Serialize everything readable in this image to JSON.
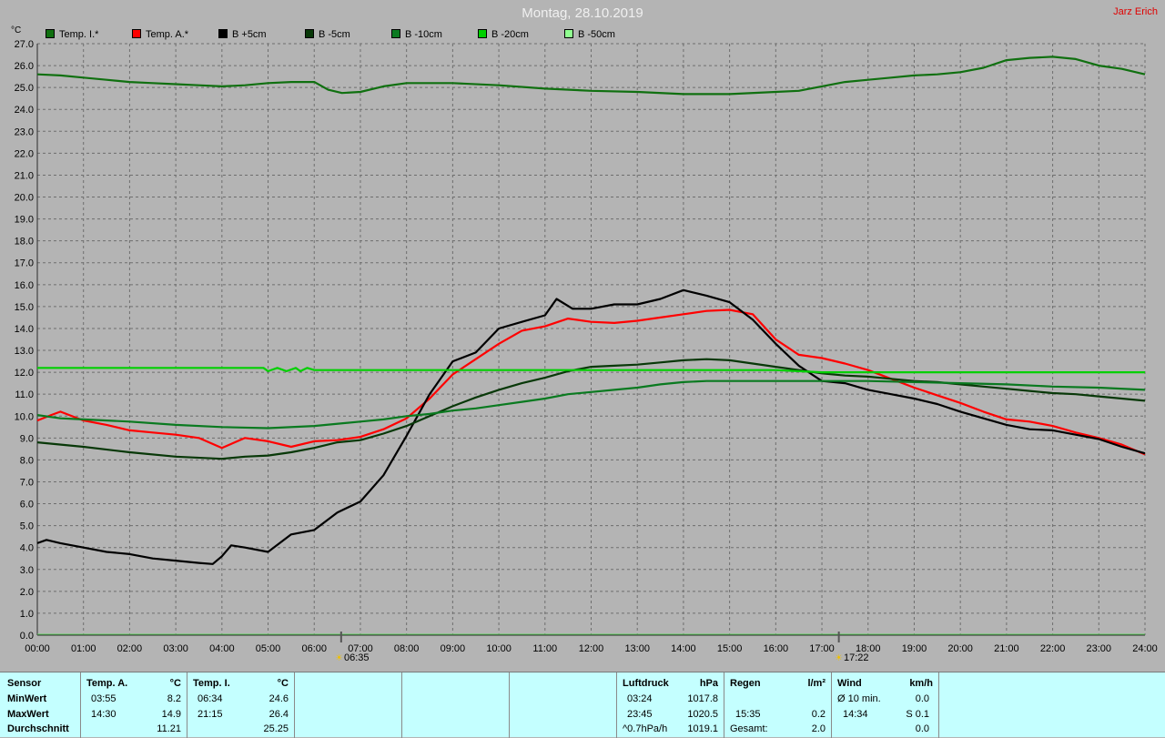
{
  "header": {
    "title": "Montag, 28.10.2019",
    "author": "Jarz Erich",
    "unit": "°C"
  },
  "legend": [
    {
      "label": "Temp. I.*",
      "color": "#107010"
    },
    {
      "label": "Temp. A.*",
      "color": "#ff0000"
    },
    {
      "label": "B +5cm",
      "color": "#000000"
    },
    {
      "label": "B -5cm",
      "color": "#083808"
    },
    {
      "label": "B -10cm",
      "color": "#0a7a20"
    },
    {
      "label": "B -20cm",
      "color": "#00d000"
    },
    {
      "label": "B -50cm",
      "color": "#90ff90"
    }
  ],
  "events": {
    "sunrise": "06:35",
    "sunset": "17:22"
  },
  "chart_data": {
    "type": "line",
    "ylim": [
      0,
      27
    ],
    "yticks": [
      "0.0",
      "1.0",
      "2.0",
      "3.0",
      "4.0",
      "5.0",
      "6.0",
      "7.0",
      "8.0",
      "9.0",
      "10.0",
      "11.0",
      "12.0",
      "13.0",
      "14.0",
      "15.0",
      "16.0",
      "17.0",
      "18.0",
      "19.0",
      "20.0",
      "21.0",
      "22.0",
      "23.0",
      "24.0",
      "25.0",
      "26.0",
      "27.0"
    ],
    "xlim": [
      0,
      24
    ],
    "xticks": [
      "00:00",
      "01:00",
      "02:00",
      "03:00",
      "04:00",
      "05:00",
      "06:00",
      "07:00",
      "08:00",
      "09:00",
      "10:00",
      "11:00",
      "12:00",
      "13:00",
      "14:00",
      "15:00",
      "16:00",
      "17:00",
      "18:00",
      "19:00",
      "20:00",
      "21:00",
      "22:00",
      "23:00",
      "24:00"
    ],
    "series": [
      {
        "name": "Temp. I.*",
        "color": "#107010",
        "x": [
          0,
          0.5,
          1,
          1.5,
          2,
          2.5,
          3,
          3.5,
          4,
          4.5,
          5,
          5.5,
          6,
          6.3,
          6.6,
          7,
          7.5,
          8,
          8.5,
          9,
          10,
          11,
          12,
          13,
          14,
          15,
          16,
          16.5,
          17,
          17.5,
          18,
          18.5,
          19,
          19.5,
          20,
          20.5,
          21,
          21.5,
          22,
          22.5,
          23,
          23.5,
          24
        ],
        "y": [
          25.6,
          25.55,
          25.45,
          25.35,
          25.25,
          25.2,
          25.15,
          25.1,
          25.05,
          25.1,
          25.2,
          25.25,
          25.25,
          24.9,
          24.75,
          24.8,
          25.05,
          25.2,
          25.2,
          25.2,
          25.1,
          24.95,
          24.85,
          24.8,
          24.7,
          24.7,
          24.8,
          24.85,
          25.05,
          25.25,
          25.35,
          25.45,
          25.55,
          25.6,
          25.7,
          25.9,
          26.25,
          26.35,
          26.4,
          26.3,
          26,
          25.85,
          25.6
        ]
      },
      {
        "name": "Temp. A.*",
        "color": "#ff0000",
        "x": [
          0,
          0.3,
          0.5,
          1,
          1.5,
          2,
          2.5,
          3,
          3.5,
          4,
          4.5,
          5,
          5.5,
          6,
          6.5,
          7,
          7.5,
          8,
          8.5,
          9,
          9.5,
          10,
          10.5,
          11,
          11.5,
          12,
          12.5,
          13,
          13.5,
          14,
          14.5,
          15,
          15.5,
          16,
          16.5,
          17,
          17.5,
          18,
          18.5,
          19,
          19.5,
          20,
          20.5,
          21,
          21.5,
          22,
          22.5,
          23,
          23.5,
          24
        ],
        "y": [
          9.8,
          10.05,
          10.2,
          9.8,
          9.6,
          9.35,
          9.25,
          9.15,
          9.0,
          8.55,
          9.0,
          8.85,
          8.6,
          8.85,
          8.9,
          9.05,
          9.4,
          9.9,
          10.8,
          11.9,
          12.6,
          13.3,
          13.9,
          14.1,
          14.45,
          14.3,
          14.25,
          14.35,
          14.5,
          14.65,
          14.8,
          14.85,
          14.65,
          13.5,
          12.8,
          12.65,
          12.4,
          12.1,
          11.7,
          11.3,
          10.95,
          10.6,
          10.2,
          9.85,
          9.75,
          9.55,
          9.25,
          9.0,
          8.7,
          8.25
        ]
      },
      {
        "name": "B +5cm",
        "color": "#000000",
        "x": [
          0,
          0.2,
          0.5,
          1,
          1.5,
          2,
          2.5,
          3,
          3.5,
          3.8,
          4,
          4.2,
          4.5,
          5,
          5.5,
          6,
          6.5,
          7,
          7.5,
          8,
          8.5,
          9,
          9.5,
          10,
          10.5,
          11,
          11.25,
          11.6,
          12,
          12.5,
          13,
          13.5,
          14,
          14.5,
          15,
          15.5,
          16,
          16.5,
          17,
          17.5,
          18,
          18.5,
          19,
          19.5,
          20,
          20.5,
          21,
          21.5,
          22,
          22.5,
          23,
          23.5,
          24
        ],
        "y": [
          4.2,
          4.35,
          4.2,
          4.0,
          3.8,
          3.7,
          3.5,
          3.4,
          3.3,
          3.25,
          3.6,
          4.1,
          4.0,
          3.8,
          4.6,
          4.8,
          5.6,
          6.1,
          7.3,
          9.1,
          11.0,
          12.5,
          12.9,
          14.0,
          14.3,
          14.6,
          15.35,
          14.9,
          14.9,
          15.1,
          15.1,
          15.35,
          15.75,
          15.5,
          15.2,
          14.4,
          13.3,
          12.3,
          11.6,
          11.5,
          11.2,
          11.0,
          10.8,
          10.55,
          10.2,
          9.9,
          9.6,
          9.4,
          9.35,
          9.15,
          8.95,
          8.6,
          8.3
        ]
      },
      {
        "name": "B -5cm",
        "color": "#083808",
        "x": [
          0,
          1,
          2,
          3,
          4,
          4.5,
          5,
          5.5,
          6,
          6.5,
          7,
          7.5,
          8,
          8.5,
          9,
          9.5,
          10,
          10.5,
          11,
          11.5,
          12,
          12.5,
          13,
          13.5,
          14,
          14.5,
          15,
          15.5,
          16,
          16.5,
          17,
          17.5,
          18,
          18.5,
          19,
          19.5,
          20,
          20.5,
          21,
          21.5,
          22,
          22.5,
          23,
          23.5,
          24
        ],
        "y": [
          8.8,
          8.6,
          8.35,
          8.15,
          8.05,
          8.15,
          8.2,
          8.35,
          8.55,
          8.8,
          8.9,
          9.2,
          9.55,
          10.0,
          10.45,
          10.85,
          11.2,
          11.5,
          11.75,
          12.05,
          12.25,
          12.3,
          12.35,
          12.45,
          12.55,
          12.6,
          12.55,
          12.4,
          12.25,
          12.1,
          11.95,
          11.85,
          11.8,
          11.7,
          11.6,
          11.55,
          11.45,
          11.35,
          11.25,
          11.15,
          11.05,
          11.0,
          10.9,
          10.8,
          10.7
        ]
      },
      {
        "name": "B -10cm",
        "color": "#0a7a20",
        "x": [
          0,
          0.5,
          1,
          2,
          3,
          4,
          5,
          6,
          7,
          7.5,
          8,
          8.5,
          9,
          9.5,
          10,
          10.5,
          11,
          11.5,
          12,
          12.5,
          13,
          13.5,
          14,
          14.5,
          15,
          16,
          17,
          17.5,
          18,
          19,
          20,
          21,
          22,
          23,
          24
        ],
        "y": [
          10.05,
          9.9,
          9.85,
          9.75,
          9.6,
          9.5,
          9.45,
          9.55,
          9.75,
          9.85,
          10.0,
          10.1,
          10.25,
          10.35,
          10.5,
          10.65,
          10.8,
          11.0,
          11.1,
          11.2,
          11.3,
          11.45,
          11.55,
          11.6,
          11.6,
          11.6,
          11.6,
          11.6,
          11.6,
          11.55,
          11.5,
          11.45,
          11.35,
          11.3,
          11.2
        ]
      },
      {
        "name": "B -20cm",
        "color": "#00d000",
        "x": [
          0,
          1,
          2,
          3,
          4,
          4.9,
          5.0,
          5.2,
          5.4,
          5.6,
          5.7,
          5.85,
          6,
          7,
          8,
          9,
          10,
          11,
          12,
          13,
          14,
          15,
          16,
          17,
          18,
          19,
          20,
          21,
          22,
          23,
          24
        ],
        "y": [
          12.2,
          12.2,
          12.2,
          12.2,
          12.2,
          12.2,
          12.05,
          12.2,
          12.05,
          12.2,
          12.05,
          12.2,
          12.1,
          12.1,
          12.1,
          12.1,
          12.1,
          12.1,
          12.1,
          12.1,
          12.1,
          12.1,
          12.1,
          12.0,
          12.0,
          12.0,
          12.0,
          12.0,
          12.0,
          12.0,
          12.0
        ]
      },
      {
        "name": "B -50cm",
        "color": "#90ff90",
        "x": [],
        "y": []
      }
    ]
  },
  "stats": {
    "sensor": {
      "h": "Sensor",
      "min": "MinWert",
      "max": "MaxWert",
      "avg": "Durchschnitt"
    },
    "temp_a": {
      "h": "Temp. A.",
      "u": "°C",
      "min_t": "03:55",
      "min_v": "8.2",
      "max_t": "14:30",
      "max_v": "14.9",
      "avg_v": "11.21"
    },
    "temp_i": {
      "h": "Temp. I.",
      "u": "°C",
      "min_t": "06:34",
      "min_v": "24.6",
      "max_t": "21:15",
      "max_v": "26.4",
      "avg_v": "25.25"
    },
    "luft": {
      "h": "Luftdruck",
      "u": "hPa",
      "r1_t": "03:24",
      "r1_v": "1017.8",
      "r2_t": "23:45",
      "r2_v": "1020.5",
      "r3_t": "^0.7hPa/h",
      "r3_v": "1019.1"
    },
    "regen": {
      "h": "Regen",
      "u": "l/m²",
      "r2_t": "15:35",
      "r2_v": "0.2",
      "r3_t": "Gesamt:",
      "r3_v": "2.0"
    },
    "wind": {
      "h": "Wind",
      "u": "km/h",
      "r1_t": "Ø 10 min.",
      "r1_v": "0.0",
      "r2_t": "14:34",
      "r2_v": "S 0.1",
      "r3_v": "0.0"
    }
  }
}
